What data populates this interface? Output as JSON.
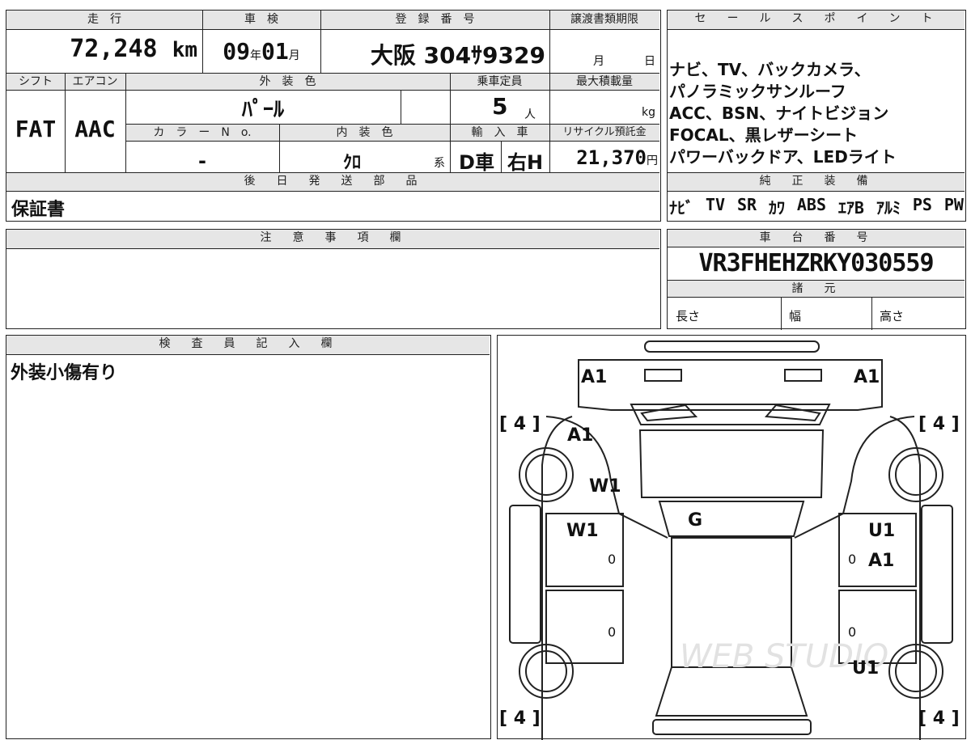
{
  "top_info": {
    "headers": {
      "mileage": "走　行",
      "inspection": "車　検",
      "registration": "登　録　番　号",
      "transfer_deadline": "譲渡書類期限",
      "shift": "シフト",
      "aircon": "エアコン",
      "exterior_color": "外　装　色",
      "capacity": "乗車定員",
      "max_load": "最大積載量",
      "color_no": "カ　ラ　ー　N　o.",
      "interior_color": "内　装　色",
      "import": "輸　入　車",
      "recycle": "リサイクル預託金"
    },
    "mileage_value": "72,248",
    "mileage_unit": "km",
    "inspection_year": "09",
    "inspection_year_unit": "年",
    "inspection_month": "01",
    "inspection_month_unit": "月",
    "registration_value": "大阪 304ｻ9329",
    "deadline_month_unit": "月",
    "deadline_day_unit": "日",
    "shift_value": "FAT",
    "aircon_value": "AAC",
    "exterior_color_value": "ﾊﾟｰﾙ",
    "capacity_value": "5",
    "capacity_unit": "人",
    "max_load_unit": "kg",
    "color_no_value": "-",
    "interior_color_value": "ｸﾛ",
    "interior_color_suffix": "系",
    "import_value": "D車",
    "handle_value": "右H",
    "recycle_value": "21,370",
    "recycle_unit": "円"
  },
  "later_parts": {
    "header": "後　日　発　送　部　品",
    "value": "保証書"
  },
  "notes": {
    "header": "注　意　事　項　欄"
  },
  "sales_points": {
    "header": "セ　ー　ル　ス　ポ　イ　ン　ト",
    "lines": [
      "ナビ、TV、バックカメラ、",
      "パノラミックサンルーフ",
      "ACC、BSN、ナイトビジョン",
      "FOCAL、黒レザーシート",
      "パワーバックドア、LEDライト"
    ]
  },
  "equipment": {
    "header": "純　正　装　備",
    "items": [
      "ﾅﾋﾞ",
      "TV",
      "SR",
      "ｶﾜ",
      "ABS",
      "ｴｱB",
      "ｱﾙﾐ",
      "PS",
      "PW"
    ]
  },
  "chassis": {
    "header": "車　台　番　号",
    "value": "VR3FHEHZRKY030559"
  },
  "specs": {
    "header": "諸　元",
    "length_label": "長さ",
    "width_label": "幅",
    "height_label": "高さ"
  },
  "inspector": {
    "header": "検　査　員　記　入　欄",
    "comment": "外装小傷有り"
  },
  "diagram": {
    "tire_marks": [
      "[ 4 ]",
      "[ 4 ]",
      "[ 4 ]",
      "[ 4 ]"
    ],
    "marks": {
      "front_left": "A1",
      "front_right": "A1",
      "hood_left": "A1",
      "fender_left": "W1",
      "windshield": "G",
      "front_door_left": "W1",
      "front_door_right_top": "U1",
      "front_door_right": "A1",
      "rear_right": "U1"
    },
    "zeros": [
      "0",
      "0",
      "0",
      "0"
    ],
    "watermark": "WEB STUDIO"
  }
}
